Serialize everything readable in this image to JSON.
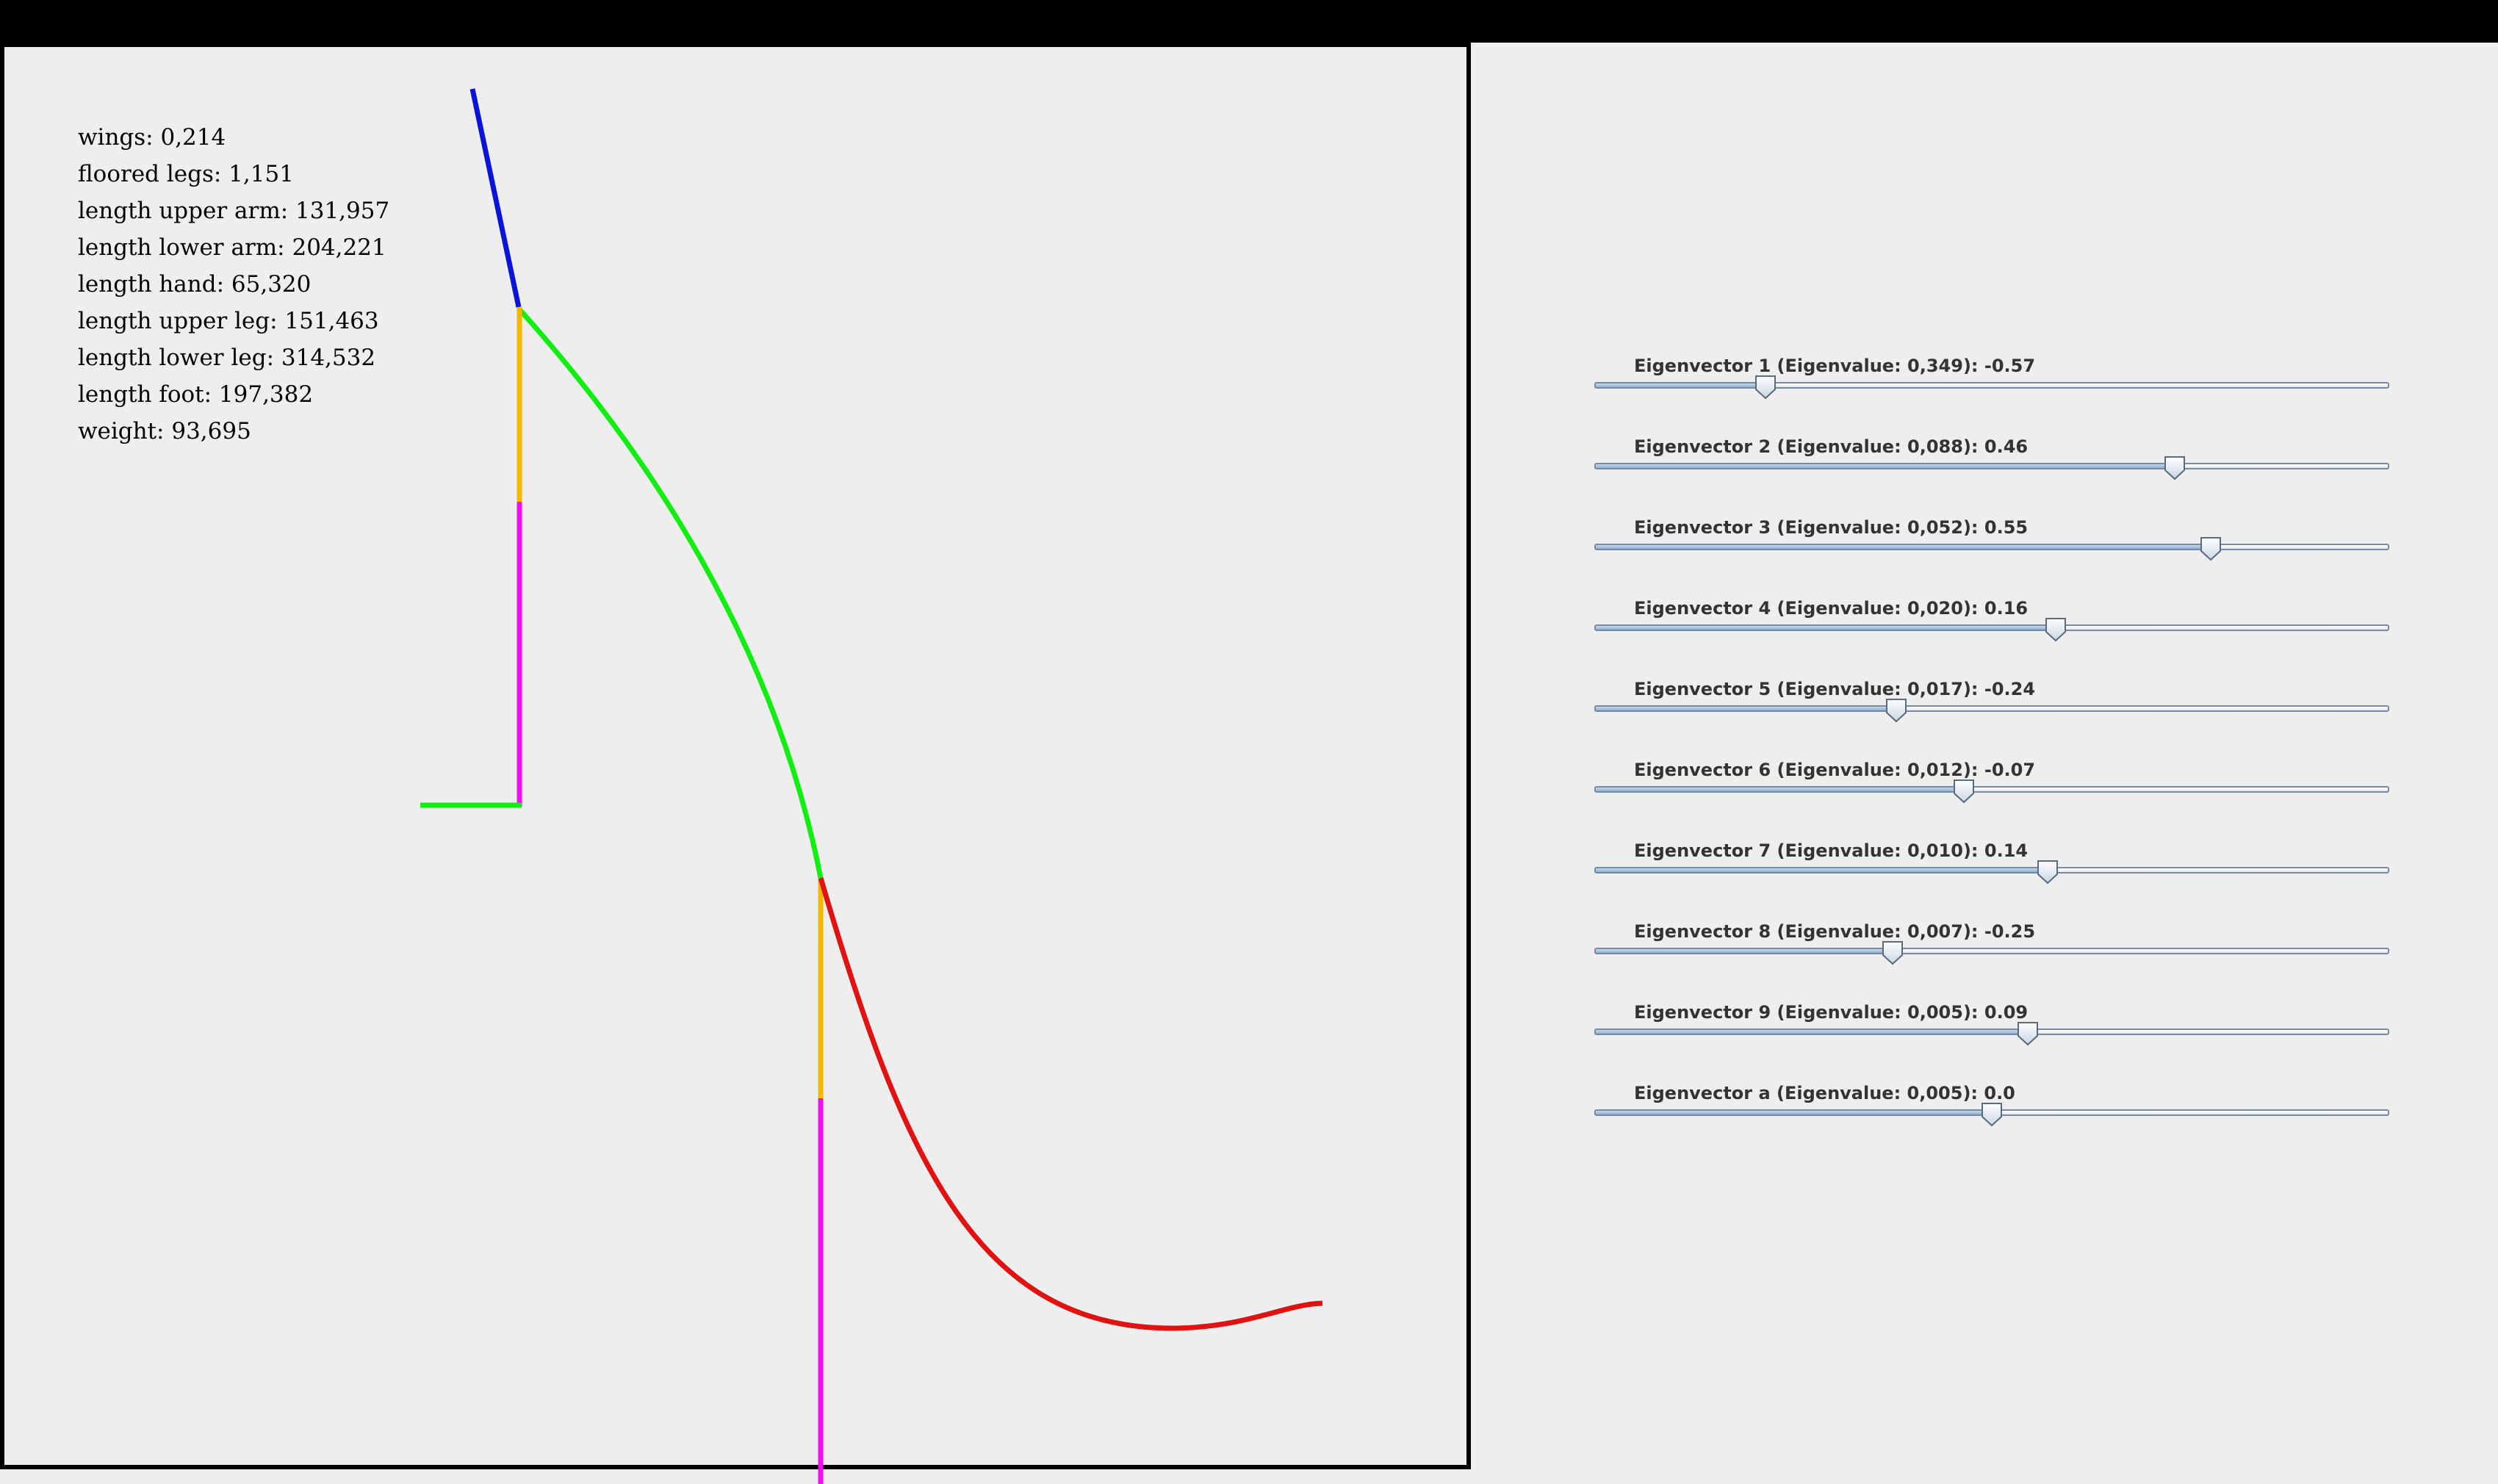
{
  "stats": {
    "wings": "wings: 0,214",
    "floored_legs": "floored legs: 1,151",
    "length_upper_arm": "length upper arm: 131,957",
    "length_lower_arm": "length lower arm: 204,221",
    "length_hand": "length hand: 65,320",
    "length_upper_leg": "length upper leg: 151,463",
    "length_lower_leg": "length lower leg: 314,532",
    "length_foot": "length foot: 197,382",
    "weight": "weight: 93,695"
  },
  "colors": {
    "hand": "#0a14d8",
    "arm": "#12ee12",
    "upper_segment": "#f5b800",
    "lower_segment": "#ee10ee",
    "leg_curve": "#e01212",
    "foot": "#12ee12"
  },
  "sliders": [
    {
      "label": "Eigenvector 1 (Eigenvalue: 0,349): -0.57",
      "value": -0.57
    },
    {
      "label": "Eigenvector 2 (Eigenvalue: 0,088): 0.46",
      "value": 0.46
    },
    {
      "label": "Eigenvector 3 (Eigenvalue: 0,052): 0.55",
      "value": 0.55
    },
    {
      "label": "Eigenvector 4 (Eigenvalue: 0,020): 0.16",
      "value": 0.16
    },
    {
      "label": "Eigenvector 5 (Eigenvalue: 0,017): -0.24",
      "value": -0.24
    },
    {
      "label": "Eigenvector 6 (Eigenvalue: 0,012): -0.07",
      "value": -0.07
    },
    {
      "label": "Eigenvector 7 (Eigenvalue: 0,010): 0.14",
      "value": 0.14
    },
    {
      "label": "Eigenvector 8 (Eigenvalue: 0,007): -0.25",
      "value": -0.25
    },
    {
      "label": "Eigenvector 9 (Eigenvalue: 0,005): 0.09",
      "value": 0.09
    },
    {
      "label": "Eigenvector a (Eigenvalue: 0,005): 0.0",
      "value": 0.0
    }
  ]
}
